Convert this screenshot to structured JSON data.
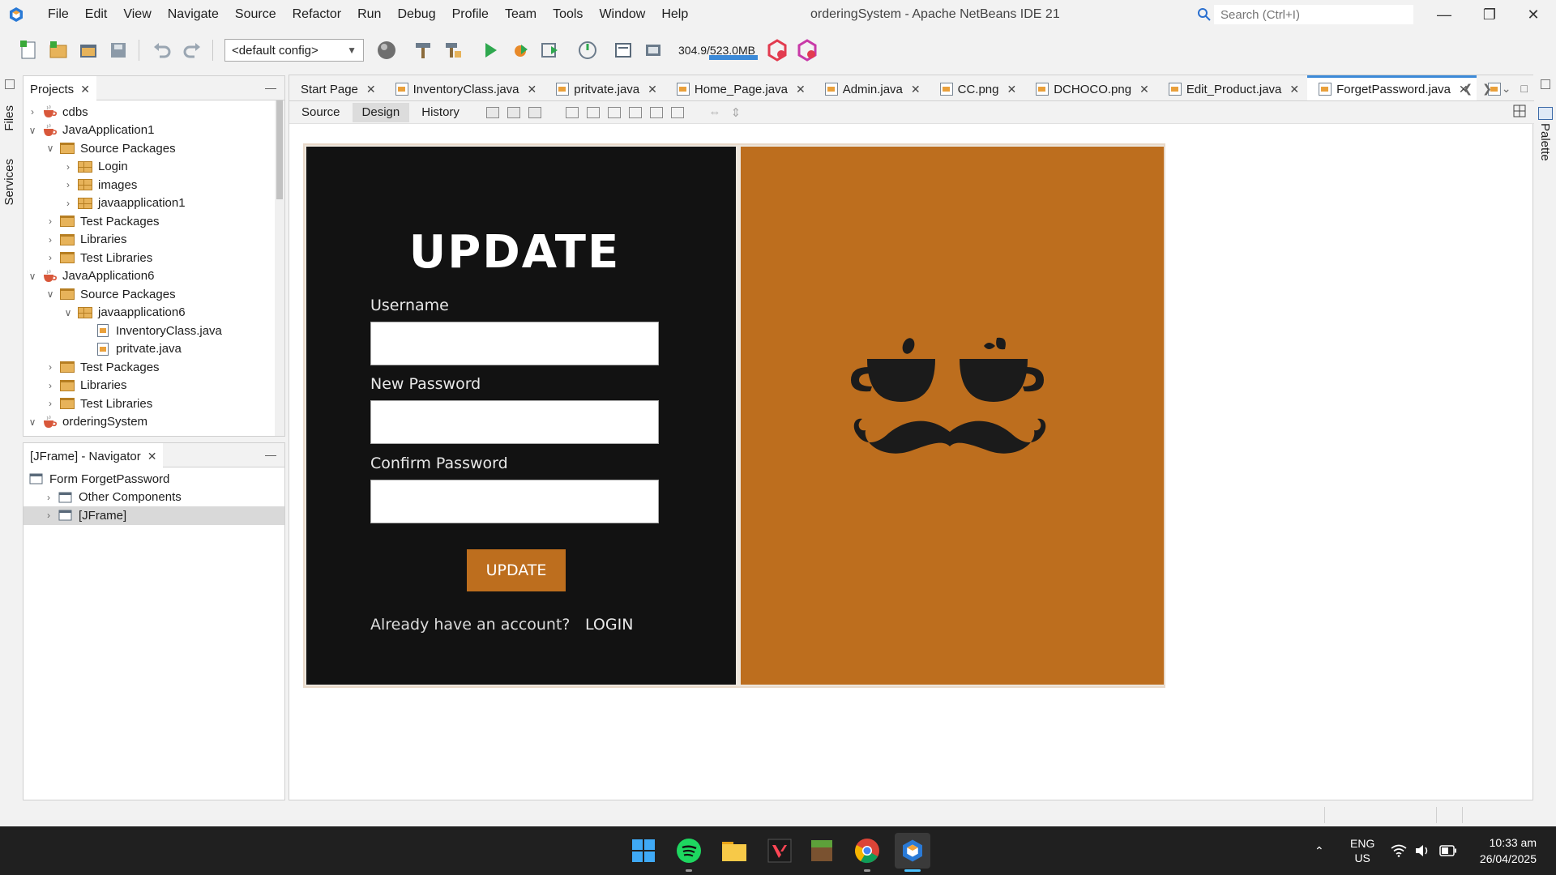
{
  "window": {
    "title": "orderingSystem - Apache NetBeans IDE 21",
    "search_placeholder": "Search (Ctrl+I)",
    "menu": [
      "File",
      "Edit",
      "View",
      "Navigate",
      "Source",
      "Refactor",
      "Run",
      "Debug",
      "Profile",
      "Team",
      "Tools",
      "Window",
      "Help"
    ]
  },
  "toolbar": {
    "config": "<default config>",
    "memory": "304.9/523.0MB"
  },
  "side_tabs": {
    "files": "Files",
    "services": "Services",
    "palette": "Palette"
  },
  "projects": {
    "tab_label": "Projects",
    "tree": [
      {
        "label": "cdbs",
        "depth": 0,
        "icon": "project-icon",
        "expanded": false
      },
      {
        "label": "JavaApplication1",
        "depth": 0,
        "icon": "project-icon",
        "expanded": true
      },
      {
        "label": "Source Packages",
        "depth": 1,
        "icon": "folder-icon",
        "expanded": true
      },
      {
        "label": "Login",
        "depth": 2,
        "icon": "package-icon",
        "expanded": false
      },
      {
        "label": "images",
        "depth": 2,
        "icon": "package-icon",
        "expanded": false
      },
      {
        "label": "javaapplication1",
        "depth": 2,
        "icon": "package-icon",
        "expanded": false
      },
      {
        "label": "Test Packages",
        "depth": 1,
        "icon": "folder-icon",
        "expanded": false
      },
      {
        "label": "Libraries",
        "depth": 1,
        "icon": "folder-icon",
        "expanded": false
      },
      {
        "label": "Test Libraries",
        "depth": 1,
        "icon": "folder-icon",
        "expanded": false
      },
      {
        "label": "JavaApplication6",
        "depth": 0,
        "icon": "project-icon",
        "expanded": true
      },
      {
        "label": "Source Packages",
        "depth": 1,
        "icon": "folder-icon",
        "expanded": true
      },
      {
        "label": "javaapplication6",
        "depth": 2,
        "icon": "package-icon",
        "expanded": true
      },
      {
        "label": "InventoryClass.java",
        "depth": 3,
        "icon": "java-file-icon",
        "expanded": null
      },
      {
        "label": "pritvate.java",
        "depth": 3,
        "icon": "java-file-icon",
        "expanded": null
      },
      {
        "label": "Test Packages",
        "depth": 1,
        "icon": "folder-icon",
        "expanded": false
      },
      {
        "label": "Libraries",
        "depth": 1,
        "icon": "folder-icon",
        "expanded": false
      },
      {
        "label": "Test Libraries",
        "depth": 1,
        "icon": "folder-icon",
        "expanded": false
      },
      {
        "label": "orderingSystem",
        "depth": 0,
        "icon": "project-icon",
        "expanded": true
      }
    ]
  },
  "navigator": {
    "tab_label": "[JFrame] - Navigator",
    "tree": [
      {
        "label": "Form ForgetPassword",
        "depth": 0,
        "expanded": null
      },
      {
        "label": "Other Components",
        "depth": 1,
        "expanded": false
      },
      {
        "label": "[JFrame]",
        "depth": 1,
        "expanded": false,
        "selected": true
      }
    ]
  },
  "editor": {
    "tabs": [
      {
        "label": "Start Page",
        "active": false,
        "icon": false
      },
      {
        "label": "InventoryClass.java",
        "active": false,
        "icon": true
      },
      {
        "label": "pritvate.java",
        "active": false,
        "icon": true
      },
      {
        "label": "Home_Page.java",
        "active": false,
        "icon": true
      },
      {
        "label": "Admin.java",
        "active": false,
        "icon": true
      },
      {
        "label": "CC.png",
        "active": false,
        "icon": true
      },
      {
        "label": "DCHOCO.png",
        "active": false,
        "icon": true
      },
      {
        "label": "Edit_Product.java",
        "active": false,
        "icon": true
      },
      {
        "label": "ForgetPassword.java",
        "active": true,
        "icon": true
      }
    ],
    "view_tabs": [
      {
        "label": "Source",
        "active": false
      },
      {
        "label": "Design",
        "active": true
      },
      {
        "label": "History",
        "active": false
      }
    ]
  },
  "form": {
    "title": "UPDATE",
    "username_label": "Username",
    "new_password_label": "New Password",
    "confirm_password_label": "Confirm Password",
    "update_button": "UPDATE",
    "account_text": "Already have an account?",
    "login_link": "LOGIN",
    "colors": {
      "dark_panel": "#121212",
      "accent": "#bd6e1e"
    }
  },
  "taskbar": {
    "language": "ENG",
    "region": "US",
    "time": "10:33 am",
    "date": "26/04/2025",
    "apps": [
      "windows-start-icon",
      "spotify-icon",
      "file-explorer-icon",
      "valorant-icon",
      "minecraft-icon",
      "chrome-icon",
      "netbeans-icon"
    ]
  }
}
